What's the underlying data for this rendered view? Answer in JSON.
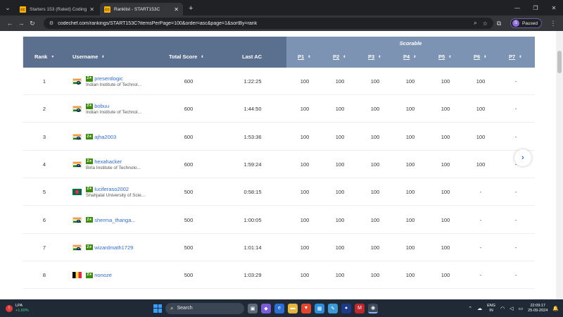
{
  "browser": {
    "tabs": [
      {
        "favicon": "CC",
        "title": "Starters 153 (Rated) Coding Co",
        "active": false
      },
      {
        "favicon": "CC",
        "title": "Ranklist - START153C",
        "active": true
      }
    ],
    "url": "codechef.com/rankings/START153C?itemsPerPage=100&order=asc&page=1&sortBy=rank",
    "profile_initial": "S",
    "profile_status": "Paused"
  },
  "table": {
    "scorable_label": "Scorable",
    "headers": {
      "rank": "Rank",
      "username": "Username",
      "total_score": "Total Score",
      "last_ac": "Last AC",
      "problems": [
        "P1",
        "P2",
        "P3",
        "P4",
        "P5",
        "P6",
        "P7"
      ]
    },
    "rows": [
      {
        "rank": "1",
        "flag": "in",
        "stars": "2★",
        "username": "presentlogic",
        "institution": "Indian Institute of Technol...",
        "total": "600",
        "last_ac": "1:22:25",
        "scores": [
          "100",
          "100",
          "100",
          "100",
          "100",
          "100",
          "-"
        ]
      },
      {
        "rank": "2",
        "flag": "in",
        "stars": "2★",
        "username": "bobuu",
        "institution": "Indian Institute of Technol...",
        "total": "600",
        "last_ac": "1:44:50",
        "scores": [
          "100",
          "100",
          "100",
          "100",
          "100",
          "100",
          "-"
        ]
      },
      {
        "rank": "3",
        "flag": "in",
        "stars": "2★",
        "username": "ajha2003",
        "institution": "",
        "total": "600",
        "last_ac": "1:53:36",
        "scores": [
          "100",
          "100",
          "100",
          "100",
          "100",
          "100",
          "-"
        ]
      },
      {
        "rank": "4",
        "flag": "in",
        "stars": "2★",
        "username": "hexahacker",
        "institution": "Birla Institute of Technolo...",
        "total": "600",
        "last_ac": "1:59:24",
        "scores": [
          "100",
          "100",
          "100",
          "100",
          "100",
          "100",
          "-"
        ]
      },
      {
        "rank": "5",
        "flag": "bd",
        "stars": "2★",
        "username": "luciferaso2002",
        "institution": "Shahjalal University of Scie...",
        "total": "500",
        "last_ac": "0:58:15",
        "scores": [
          "100",
          "100",
          "100",
          "100",
          "100",
          "-",
          "-"
        ]
      },
      {
        "rank": "6",
        "flag": "in",
        "stars": "2★",
        "username": "sherma_thanga...",
        "institution": "",
        "total": "500",
        "last_ac": "1:00:05",
        "scores": [
          "100",
          "100",
          "100",
          "100",
          "100",
          "-",
          "-"
        ]
      },
      {
        "rank": "7",
        "flag": "in",
        "stars": "2★",
        "username": "wizardmath1729",
        "institution": "",
        "total": "500",
        "last_ac": "1:01:14",
        "scores": [
          "100",
          "100",
          "100",
          "100",
          "100",
          "-",
          "-"
        ]
      },
      {
        "rank": "8",
        "flag": "be",
        "stars": "2★",
        "username": "nonoze",
        "institution": "",
        "total": "500",
        "last_ac": "1:03:29",
        "scores": [
          "100",
          "100",
          "100",
          "100",
          "100",
          "-",
          "-"
        ]
      }
    ]
  },
  "taskbar": {
    "weather_title": "LPA",
    "weather_sub": "+1.60%",
    "search_placeholder": "Search",
    "lang_top": "ENG",
    "lang_bottom": "IN",
    "time": "22:09:17",
    "date": "25-09-2024"
  },
  "colors": {
    "header_bg": "#5b6f8e",
    "scorable_bg": "#7d93b3",
    "link": "#2f6bd6",
    "star_badge": "#3c8d0d"
  }
}
